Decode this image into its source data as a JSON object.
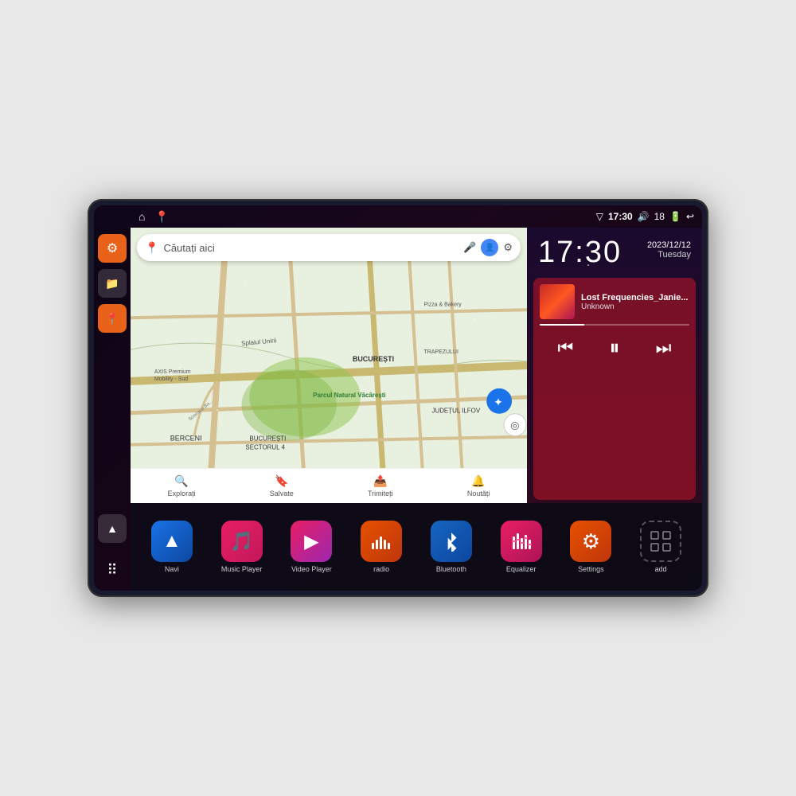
{
  "device": {
    "status_bar": {
      "time": "17:30",
      "battery": "18",
      "icons": [
        "wifi",
        "volume",
        "battery",
        "back"
      ]
    },
    "date": {
      "full": "2023/12/12",
      "day": "Tuesday"
    },
    "clock": {
      "time": "17:30"
    },
    "sidebar": {
      "buttons": [
        "settings",
        "file-manager",
        "maps",
        "arrow"
      ]
    },
    "map": {
      "search_placeholder": "Căutați aici",
      "search_text": "Căutați aici",
      "locations": [
        "AXIS Premium Mobility - Sud",
        "Pizza & Bakery",
        "Parcul Natural Văcărești",
        "BUCUREȘTI",
        "BUCUREȘTI SECTORUL 4",
        "BERCENI",
        "JUDEȚUL ILFOV",
        "TRAPEZULUI"
      ],
      "bottom_tabs": [
        "Explorați",
        "Salvate",
        "Trimiteți",
        "Noutăți"
      ]
    },
    "music": {
      "title": "Lost Frequencies_Janie...",
      "artist": "Unknown",
      "progress": 30
    },
    "apps": [
      {
        "id": "navi",
        "label": "Navi",
        "icon": "navi"
      },
      {
        "id": "music-player",
        "label": "Music Player",
        "icon": "music"
      },
      {
        "id": "video-player",
        "label": "Video Player",
        "icon": "video"
      },
      {
        "id": "radio",
        "label": "radio",
        "icon": "radio"
      },
      {
        "id": "bluetooth",
        "label": "Bluetooth",
        "icon": "bluetooth"
      },
      {
        "id": "equalizer",
        "label": "Equalizer",
        "icon": "eq"
      },
      {
        "id": "settings",
        "label": "Settings",
        "icon": "settings"
      },
      {
        "id": "add",
        "label": "add",
        "icon": "add"
      }
    ]
  }
}
